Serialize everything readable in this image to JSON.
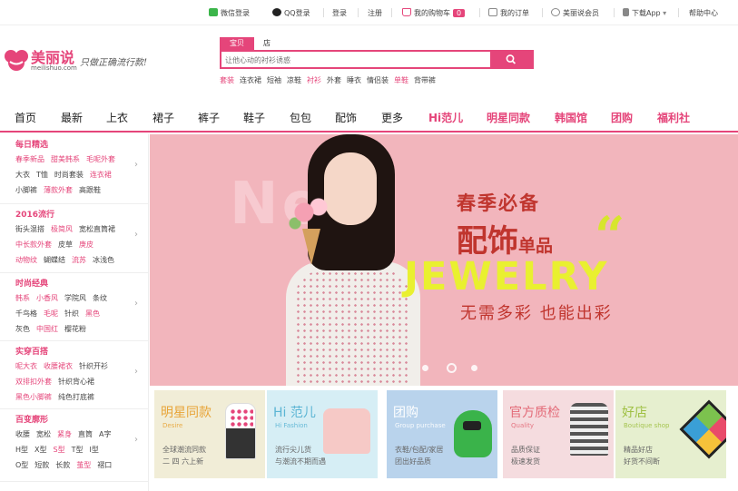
{
  "topbar": {
    "wechat_login": "微信登录",
    "qq_login": "QQ登录",
    "login": "登录",
    "register": "注册",
    "cart": "我的购物车",
    "cart_count": "0",
    "orders": "我的订单",
    "vip": "美丽说会员",
    "download_app": "下载App",
    "help": "帮助中心"
  },
  "logo": {
    "name": "美丽说",
    "domain": "meilishuo.com",
    "slogan": "只做正确流行款!"
  },
  "search": {
    "tabs": [
      "宝贝",
      "店铺"
    ],
    "active_tab": "宝贝",
    "placeholder": "让他心动的衬衫诱惑",
    "hot_keywords": [
      {
        "text": "套装",
        "highlight": true
      },
      {
        "text": "连衣裙",
        "highlight": false
      },
      {
        "text": "短袖",
        "highlight": false
      },
      {
        "text": "凉鞋",
        "highlight": false
      },
      {
        "text": "衬衫",
        "highlight": true
      },
      {
        "text": "外套",
        "highlight": false
      },
      {
        "text": "睡衣",
        "highlight": false
      },
      {
        "text": "情侣装",
        "highlight": false
      },
      {
        "text": "单鞋",
        "highlight": true
      },
      {
        "text": "背带裤",
        "highlight": false
      }
    ]
  },
  "nav": {
    "items": [
      {
        "label": "首页",
        "highlight": false
      },
      {
        "label": "最新",
        "highlight": false
      },
      {
        "label": "上衣",
        "highlight": false
      },
      {
        "label": "裙子",
        "highlight": false
      },
      {
        "label": "裤子",
        "highlight": false
      },
      {
        "label": "鞋子",
        "highlight": false
      },
      {
        "label": "包包",
        "highlight": false
      },
      {
        "label": "配饰",
        "highlight": false
      },
      {
        "label": "更多",
        "highlight": false
      },
      {
        "label": "Hi范儿",
        "highlight": true
      },
      {
        "label": "明星同款",
        "highlight": true
      },
      {
        "label": "韩国馆",
        "highlight": true
      },
      {
        "label": "团购",
        "highlight": true
      },
      {
        "label": "福利社",
        "highlight": true
      }
    ]
  },
  "sidebar": {
    "sections": [
      {
        "title": "每日精选",
        "rows": [
          [
            {
              "t": "春季新品",
              "pk": true
            },
            {
              "t": "甜美韩系",
              "pk": true
            },
            {
              "t": "毛呢外套",
              "pk": true
            }
          ],
          [
            {
              "t": "大衣",
              "pk": false
            },
            {
              "t": "T恤",
              "pk": false
            },
            {
              "t": "时尚套装",
              "pk": false
            },
            {
              "t": "连衣裙",
              "pk": true
            }
          ],
          [
            {
              "t": "小脚裤",
              "pk": false
            },
            {
              "t": "薄款外套",
              "pk": true
            },
            {
              "t": "高跟鞋",
              "pk": false
            }
          ]
        ]
      },
      {
        "title": "2016流行",
        "rows": [
          [
            {
              "t": "街头混搭",
              "pk": false
            },
            {
              "t": "极简风",
              "pk": true
            },
            {
              "t": "宽松直筒裙",
              "pk": false
            }
          ],
          [
            {
              "t": "中长款外套",
              "pk": true
            },
            {
              "t": "皮草",
              "pk": false
            },
            {
              "t": "庚皮",
              "pk": true
            }
          ],
          [
            {
              "t": "动物纹",
              "pk": true
            },
            {
              "t": "蝴蝶结",
              "pk": false
            },
            {
              "t": "流苏",
              "pk": true
            },
            {
              "t": "冰浅色",
              "pk": false
            }
          ]
        ]
      },
      {
        "title": "时尚经典",
        "rows": [
          [
            {
              "t": "韩系",
              "pk": true
            },
            {
              "t": "小香风",
              "pk": true
            },
            {
              "t": "学院风",
              "pk": false
            },
            {
              "t": "条纹",
              "pk": false
            }
          ],
          [
            {
              "t": "千鸟格",
              "pk": false
            },
            {
              "t": "毛呢",
              "pk": true
            },
            {
              "t": "针织",
              "pk": false
            },
            {
              "t": "黑色",
              "pk": true
            }
          ],
          [
            {
              "t": "灰色",
              "pk": false
            },
            {
              "t": "中国红",
              "pk": true
            },
            {
              "t": "樱花粉",
              "pk": false
            }
          ]
        ]
      },
      {
        "title": "实穿百搭",
        "rows": [
          [
            {
              "t": "呢大衣",
              "pk": true
            },
            {
              "t": "收腰裙衣",
              "pk": true
            },
            {
              "t": "针织开衫",
              "pk": false
            }
          ],
          [
            {
              "t": "双排扣外套",
              "pk": true
            },
            {
              "t": "针织背心裙",
              "pk": false
            }
          ],
          [
            {
              "t": "黑色小脚裤",
              "pk": true
            },
            {
              "t": "纯色打底裤",
              "pk": false
            }
          ]
        ]
      },
      {
        "title": "百变廓形",
        "rows": [
          [
            {
              "t": "收腰",
              "pk": false
            },
            {
              "t": "宽松",
              "pk": false
            },
            {
              "t": "紧身",
              "pk": true
            },
            {
              "t": "直筒",
              "pk": false
            },
            {
              "t": "A字",
              "pk": false
            }
          ],
          [
            {
              "t": "H型",
              "pk": false
            },
            {
              "t": "X型",
              "pk": false
            },
            {
              "t": "S型",
              "pk": true
            },
            {
              "t": "T型",
              "pk": false
            },
            {
              "t": "I型",
              "pk": false
            }
          ],
          [
            {
              "t": "O型",
              "pk": false
            },
            {
              "t": "短款",
              "pk": false
            },
            {
              "t": "长款",
              "pk": false
            },
            {
              "t": "茧型",
              "pk": true
            },
            {
              "t": "褶口",
              "pk": false
            }
          ]
        ]
      }
    ]
  },
  "banner": {
    "bg_text": "New",
    "headline1": "春季必备",
    "headline2_big": "配饰",
    "headline2_small": "单品",
    "quote_mark": "“",
    "english": "JEWELRY",
    "tagline": "无需多彩 也能出彩",
    "slide_count": 3,
    "active_slide": 1
  },
  "cards": [
    {
      "title": "明星同款",
      "en": "Desire",
      "line1": "全球潮流同款",
      "line2": "二 四 六上新",
      "bg": "#f1edd7",
      "color": "#e8a437"
    },
    {
      "title": "Hi 范儿",
      "en": "Hi Fashion",
      "line1": "流行尖儿货",
      "line2": "与潮流不期而遇",
      "bg": "#d6eef5",
      "color": "#5cb5d4"
    },
    {
      "title": "团购",
      "en": "Group purchase",
      "line1": "衣鞋/包配/家居",
      "line2": "团出好品质",
      "bg": "#b9d3ec",
      "color": "#ffffff"
    },
    {
      "title": "官方质检",
      "en": "Quality",
      "line1": "品质保证",
      "line2": "极速发货",
      "bg": "#f5dcdf",
      "color": "#e36b78"
    },
    {
      "title": "好店",
      "en": "Boutique shop",
      "line1": "精品好店",
      "line2": "好货不间断",
      "bg": "#e6efcf",
      "color": "#9fc043"
    }
  ],
  "colors": {
    "brand_pink": "#e5457a",
    "banner_bg": "#f2b5bc",
    "banner_red": "#c0352e",
    "banner_yellow": "#e9f030"
  }
}
